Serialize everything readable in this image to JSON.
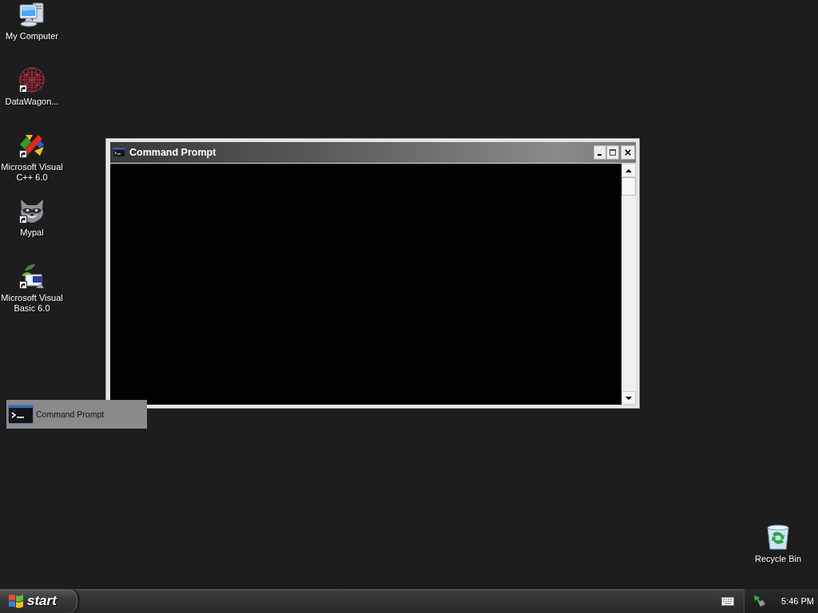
{
  "desktop_icons": [
    {
      "label": "My Computer",
      "kind": "computer",
      "shortcut": false
    },
    {
      "label": "DataWagon...",
      "kind": "mesh",
      "shortcut": true
    },
    {
      "label": "Microsoft Visual C++ 6.0",
      "kind": "compiler",
      "shortcut": true
    },
    {
      "label": "Mypal",
      "kind": "raccoon",
      "shortcut": true
    },
    {
      "label": "Microsoft Visual Basic 6.0",
      "kind": "basic",
      "shortcut": true
    }
  ],
  "window": {
    "title": "Command Prompt"
  },
  "dragged_task_button": {
    "label": "Command Prompt"
  },
  "recycle_bin": {
    "label": "Recycle Bin"
  },
  "taskbar": {
    "start_label": "start",
    "clock": "5:46 PM"
  }
}
